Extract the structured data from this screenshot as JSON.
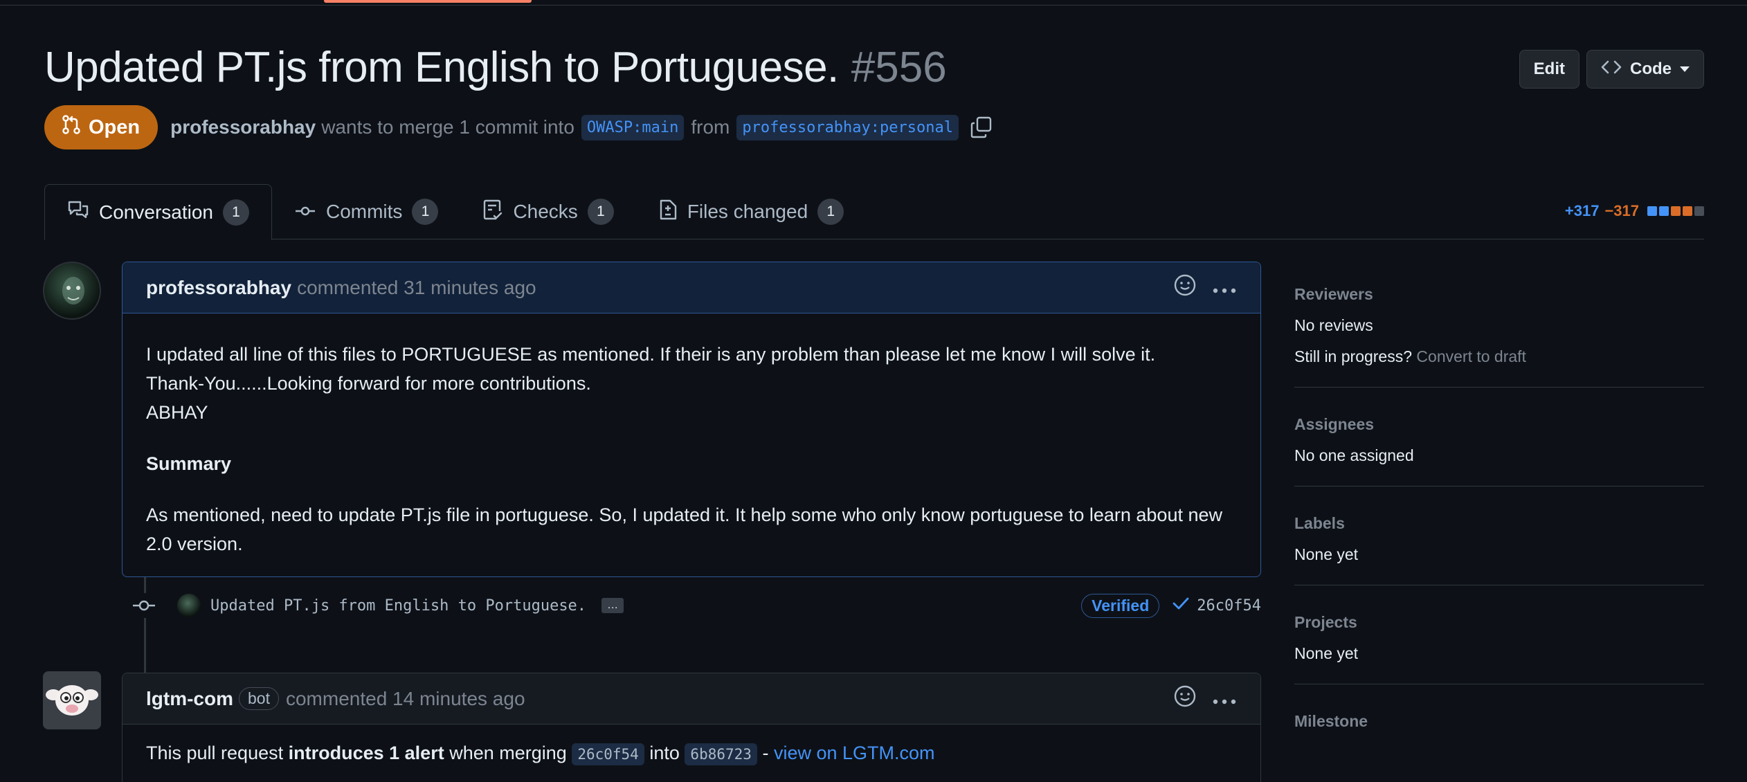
{
  "pr": {
    "title": "Updated PT.js from English to Portuguese.",
    "number": "#556",
    "state": "Open",
    "author": "professorabhay",
    "merge_text": "wants to merge 1 commit into",
    "base_branch": "OWASP:main",
    "from_text": "from",
    "head_branch": "professorabhay:personal"
  },
  "header_actions": {
    "edit_label": "Edit",
    "code_label": "Code"
  },
  "tabs": [
    {
      "label": "Conversation",
      "count": "1"
    },
    {
      "label": "Commits",
      "count": "1"
    },
    {
      "label": "Checks",
      "count": "1"
    },
    {
      "label": "Files changed",
      "count": "1"
    }
  ],
  "diffstat": {
    "additions": "+317",
    "deletions": "−317",
    "colors": [
      "#4493f8",
      "#4493f8",
      "#db6d28",
      "#db6d28",
      "#484f58"
    ]
  },
  "comment1": {
    "author": "professorabhay",
    "meta": "commented 31 minutes ago",
    "body_line1": "I updated all line of this files to PORTUGUESE as mentioned. If their is any problem than please let me know I will solve it.",
    "body_line2": "Thank-You......Looking forward for more contributions.",
    "body_line3": "ABHAY",
    "heading": "Summary",
    "paragraph": "As mentioned, need to update PT.js file in portuguese. So, I updated it. It help some who only know portuguese to learn about new 2.0 version."
  },
  "commit": {
    "message": "Updated PT.js from English to Portuguese.",
    "ellipsis": "…",
    "verified": "Verified",
    "sha": "26c0f54"
  },
  "comment2": {
    "author": "lgtm-com",
    "bot_label": "bot",
    "meta": "commented 14 minutes ago",
    "text_before": "This pull request",
    "text_bold": "introduces 1 alert",
    "text_mid": "when merging",
    "code1": "26c0f54",
    "text_into": "into",
    "code2": "6b86723",
    "text_dash": "-",
    "link": "view on LGTM.com"
  },
  "sidebar": {
    "reviewers_heading": "Reviewers",
    "reviewers_value": "No reviews",
    "in_progress": "Still in progress?",
    "convert_link": "Convert to draft",
    "assignees_heading": "Assignees",
    "assignees_value": "No one assigned",
    "labels_heading": "Labels",
    "labels_value": "None yet",
    "projects_heading": "Projects",
    "projects_value": "None yet",
    "milestone_heading": "Milestone"
  }
}
